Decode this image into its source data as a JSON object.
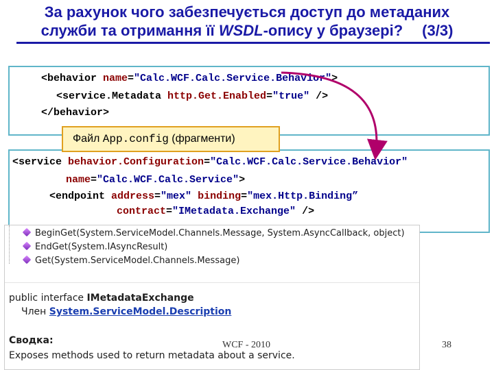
{
  "title": {
    "line1": "За рахунок чого забезпечується доступ до метаданих",
    "line2_pre": "служби та отримання її ",
    "line2_wsdl": "WSDL",
    "line2_post": "-опису у браузері?",
    "page": "(3/3)"
  },
  "code1": {
    "l1": [
      "<behavior ",
      "name",
      "=",
      "\"Calc.WCF.Calc.Service.Behavior\"",
      ">"
    ],
    "l2": [
      "<service.Metadata ",
      "http.Get.Enabled",
      "=",
      "\"true\"",
      " />"
    ],
    "l3": "</behavior>"
  },
  "config_label": {
    "prefix": "Файл ",
    "file": "App.config",
    "suffix": " (фрагменти)"
  },
  "code2": {
    "l1": [
      "<service ",
      "behavior.Configuration",
      "=",
      "\"Calc.WCF.Calc.Service.Behavior\""
    ],
    "l2": [
      "name",
      "=",
      "\"Calc.WCF.Calc.Service\"",
      ">"
    ],
    "l3": [
      "<endpoint ",
      "address",
      "=",
      "\"mex\"",
      " ",
      "binding",
      "=",
      "\"mex.Http.Binding”"
    ],
    "l4": [
      "contract",
      "=",
      "\"IMetadata.Exchange\"",
      " />"
    ]
  },
  "screenshot": {
    "methods": [
      "BeginGet(System.ServiceModel.Channels.Message, System.AsyncCallback, object)",
      "EndGet(System.IAsyncResult)",
      "Get(System.ServiceModel.Channels.Message)"
    ],
    "decl_prefix": "public interface ",
    "decl_name": "IMetadataExchange",
    "member_label": "Член ",
    "member_link": "System.ServiceModel.Description",
    "summary_heading": "Сводка:",
    "summary_text": "Exposes methods used to return metadata about a service."
  },
  "footer": {
    "center": "WCF  - 2010",
    "page": "38"
  },
  "colors": {
    "title": "#1a1aa6",
    "box_border": "#5fb5c9",
    "arrow": "#b0006a",
    "label_bg": "#fff4c0"
  }
}
